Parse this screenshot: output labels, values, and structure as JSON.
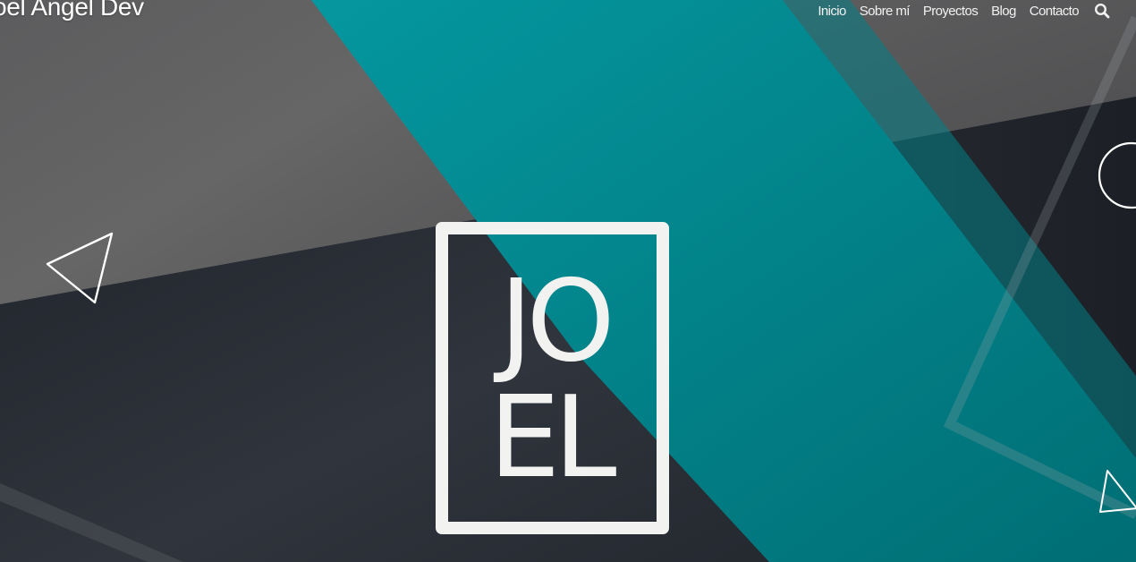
{
  "header": {
    "site_title": "oel Angel Dev"
  },
  "nav": {
    "items": [
      {
        "label": "Inicio"
      },
      {
        "label": "Sobre mí"
      },
      {
        "label": "Proyectos"
      },
      {
        "label": "Blog"
      },
      {
        "label": "Contacto"
      }
    ],
    "search_icon": "search-icon"
  },
  "hero": {
    "logo_line_1": "JO",
    "logo_line_2": "EL",
    "decorations": [
      "triangle-outline-left",
      "circle-outline-right",
      "triangle-outline-right",
      "large-translucent-triangle"
    ]
  },
  "colors": {
    "teal": "#038f97",
    "dark_navy": "#22262d",
    "gray": "#5b5b5d",
    "white": "#f2f3f1"
  }
}
